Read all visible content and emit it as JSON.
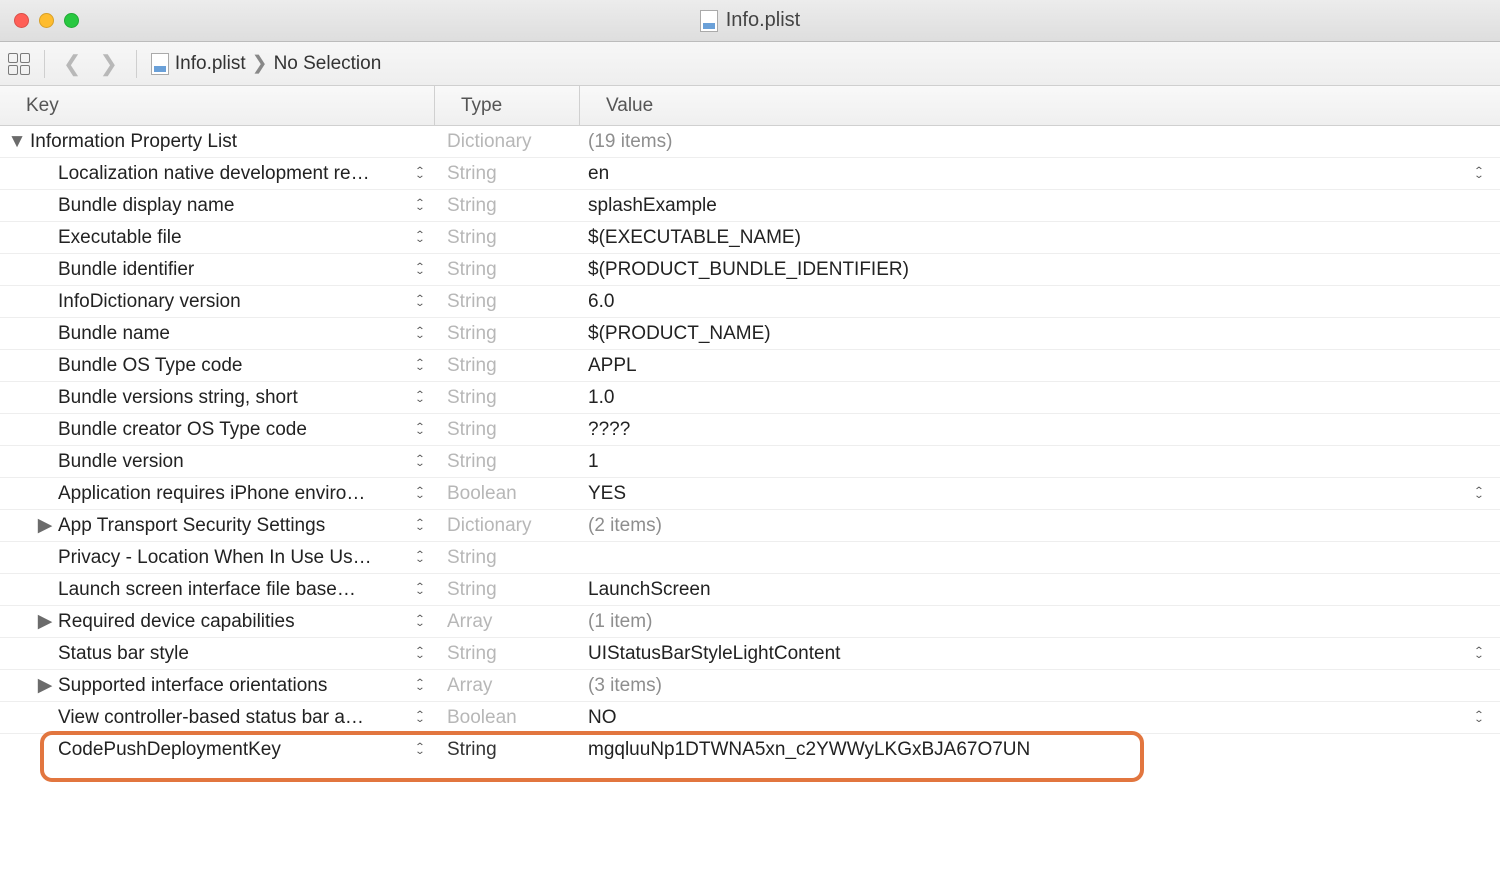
{
  "window": {
    "title": "Info.plist"
  },
  "breadcrumb": {
    "file": "Info.plist",
    "selection": "No Selection"
  },
  "columns": {
    "key": "Key",
    "type": "Type",
    "value": "Value"
  },
  "root": {
    "key": "Information Property List",
    "type": "Dictionary",
    "value": "(19 items)"
  },
  "rows": [
    {
      "key": "Localization native development re…",
      "type": "String",
      "value": "en",
      "expandable": false,
      "valueStepper": true
    },
    {
      "key": "Bundle display name",
      "type": "String",
      "value": "splashExample",
      "expandable": false,
      "valueStepper": false
    },
    {
      "key": "Executable file",
      "type": "String",
      "value": "$(EXECUTABLE_NAME)",
      "expandable": false,
      "valueStepper": false
    },
    {
      "key": "Bundle identifier",
      "type": "String",
      "value": "$(PRODUCT_BUNDLE_IDENTIFIER)",
      "expandable": false,
      "valueStepper": false
    },
    {
      "key": "InfoDictionary version",
      "type": "String",
      "value": "6.0",
      "expandable": false,
      "valueStepper": false
    },
    {
      "key": "Bundle name",
      "type": "String",
      "value": "$(PRODUCT_NAME)",
      "expandable": false,
      "valueStepper": false
    },
    {
      "key": "Bundle OS Type code",
      "type": "String",
      "value": "APPL",
      "expandable": false,
      "valueStepper": false
    },
    {
      "key": "Bundle versions string, short",
      "type": "String",
      "value": "1.0",
      "expandable": false,
      "valueStepper": false
    },
    {
      "key": "Bundle creator OS Type code",
      "type": "String",
      "value": "????",
      "expandable": false,
      "valueStepper": false
    },
    {
      "key": "Bundle version",
      "type": "String",
      "value": "1",
      "expandable": false,
      "valueStepper": false
    },
    {
      "key": "Application requires iPhone enviro…",
      "type": "Boolean",
      "value": "YES",
      "expandable": false,
      "valueStepper": true
    },
    {
      "key": "App Transport Security Settings",
      "type": "Dictionary",
      "value": "(2 items)",
      "expandable": true,
      "valueStepper": false,
      "dimValue": true
    },
    {
      "key": "Privacy - Location When In Use Us…",
      "type": "String",
      "value": "",
      "expandable": false,
      "valueStepper": false
    },
    {
      "key": "Launch screen interface file base…",
      "type": "String",
      "value": "LaunchScreen",
      "expandable": false,
      "valueStepper": false
    },
    {
      "key": "Required device capabilities",
      "type": "Array",
      "value": "(1 item)",
      "expandable": true,
      "valueStepper": false,
      "dimValue": true
    },
    {
      "key": "Status bar style",
      "type": "String",
      "value": "UIStatusBarStyleLightContent",
      "expandable": false,
      "valueStepper": true
    },
    {
      "key": "Supported interface orientations",
      "type": "Array",
      "value": "(3 items)",
      "expandable": true,
      "valueStepper": false,
      "dimValue": true
    },
    {
      "key": "View controller-based status bar a…",
      "type": "Boolean",
      "value": "NO",
      "expandable": false,
      "valueStepper": true
    },
    {
      "key": "CodePushDeploymentKey",
      "type": "String",
      "value": "mgqluuNp1DTWNA5xn_c2YWWyLKGxBJA67O7UN",
      "expandable": false,
      "valueStepper": false,
      "highlighted": true
    }
  ]
}
